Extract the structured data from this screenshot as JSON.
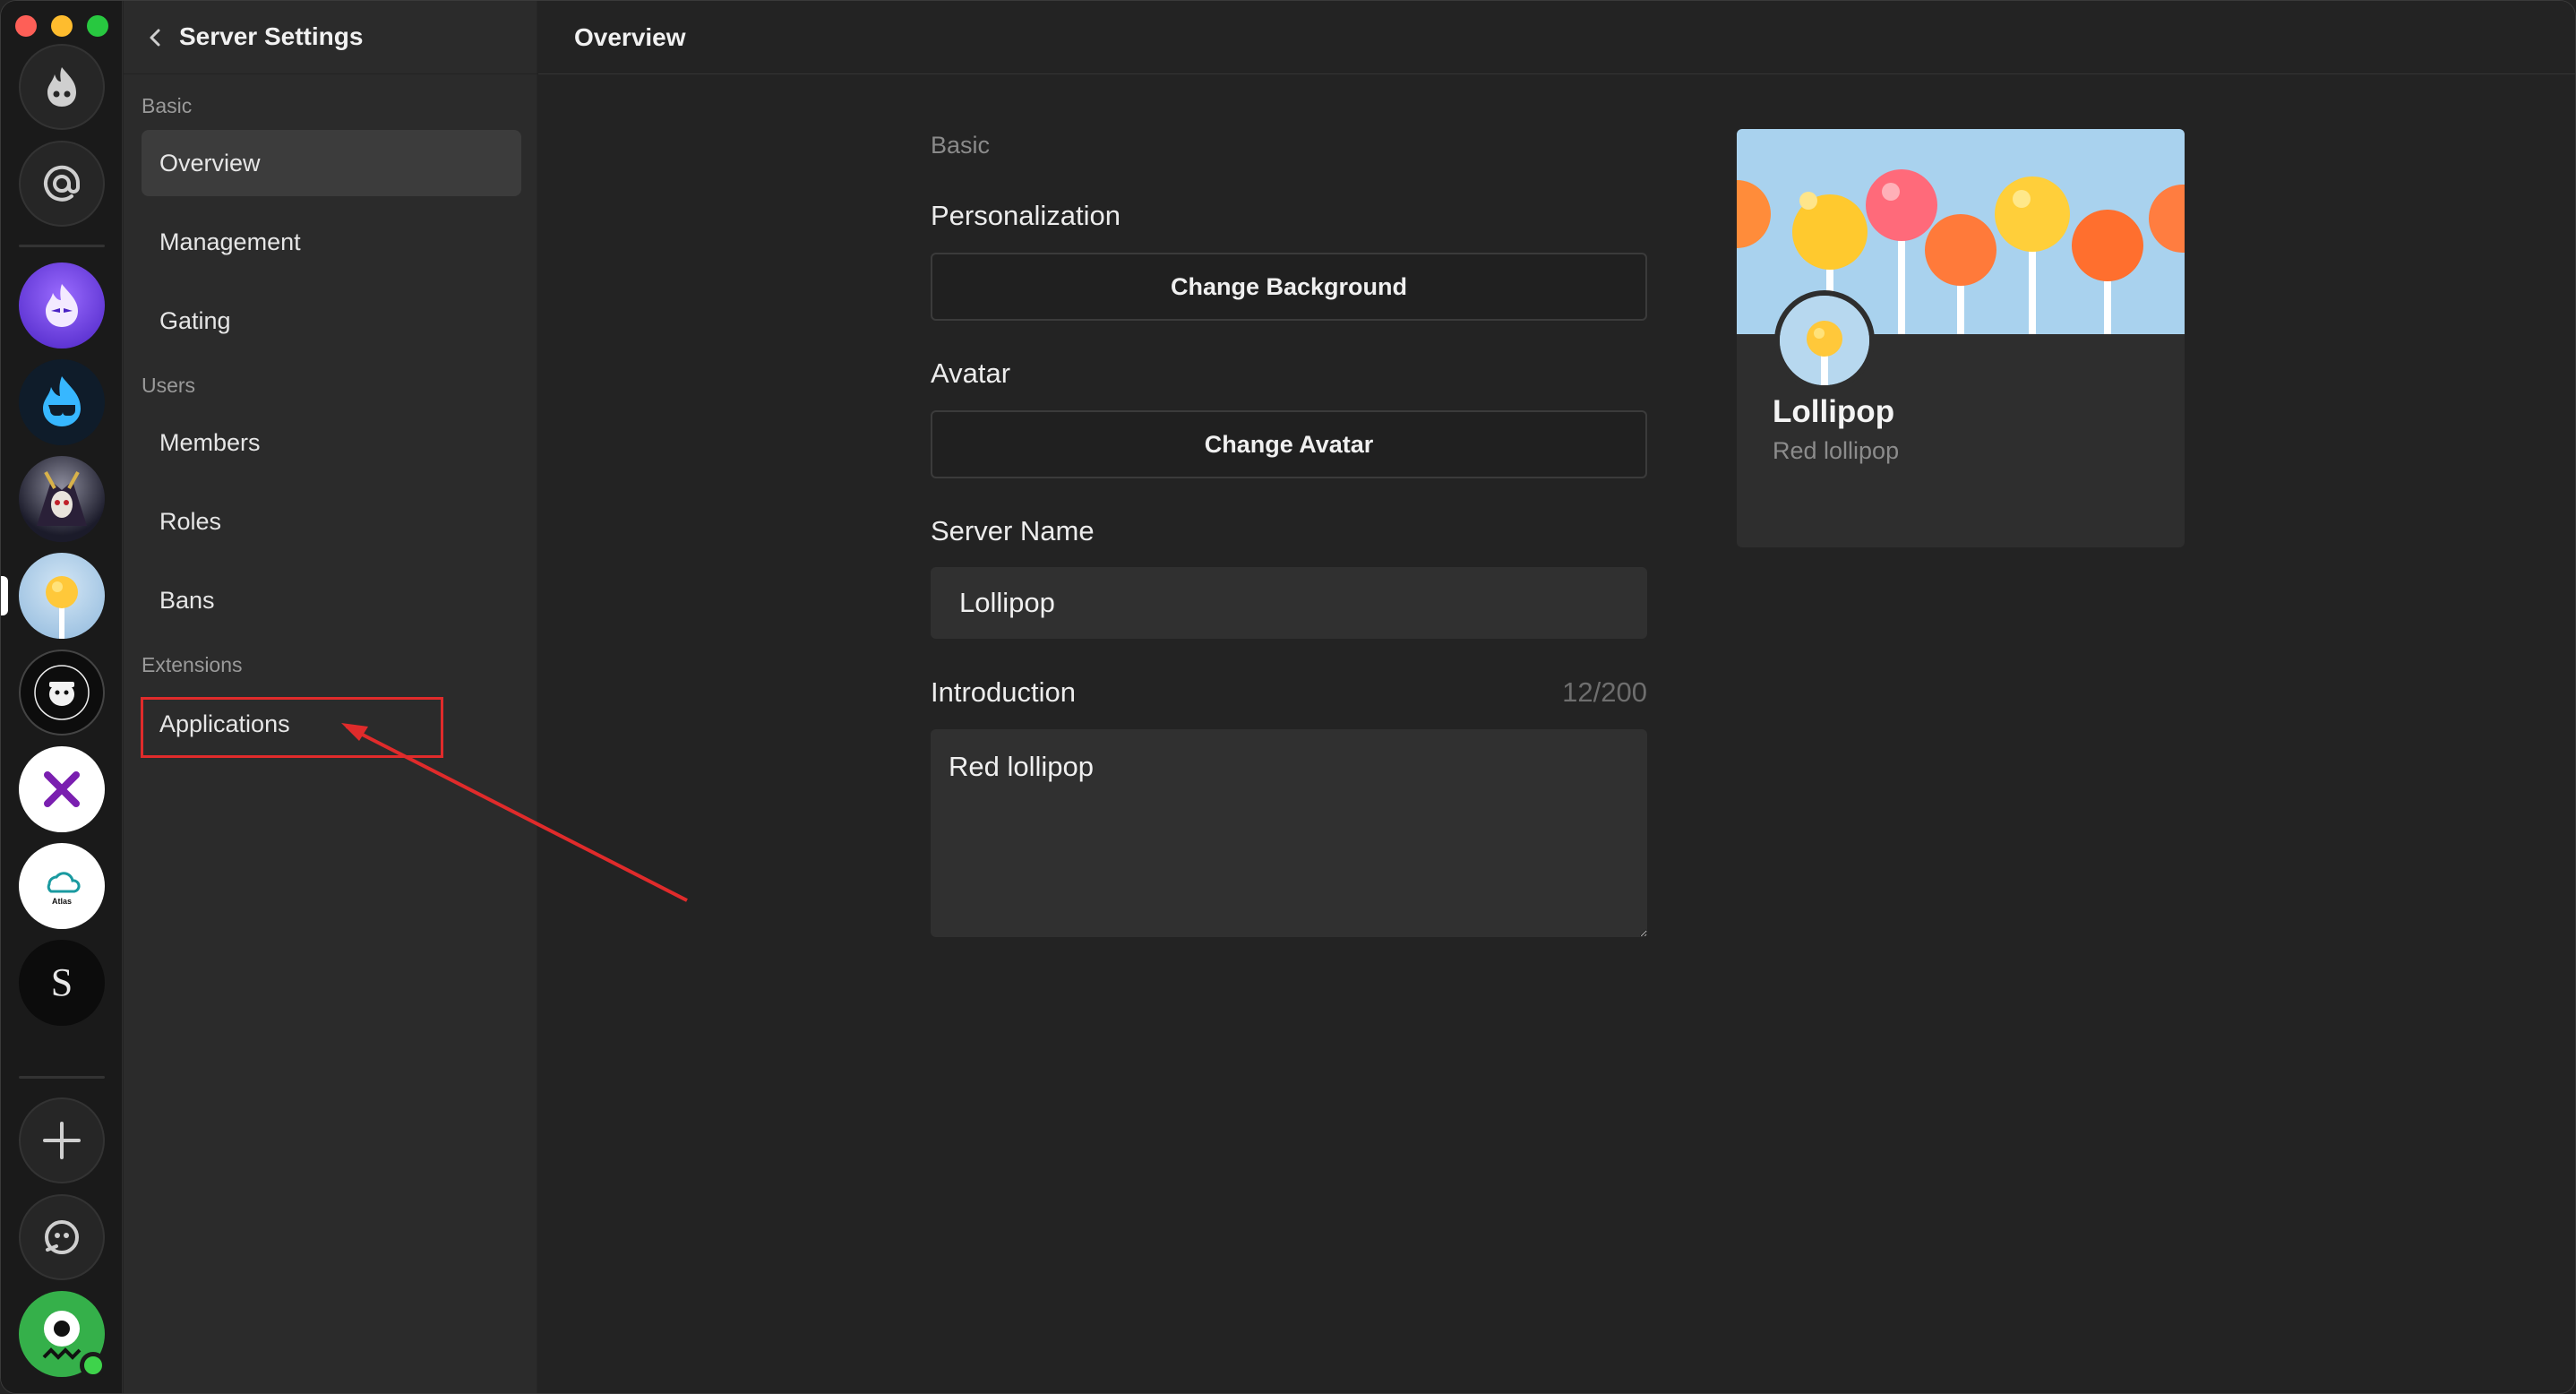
{
  "nav": {
    "title": "Server Settings",
    "sections": {
      "basic": "Basic",
      "users": "Users",
      "extensions": "Extensions"
    },
    "items": {
      "overview": "Overview",
      "management": "Management",
      "gating": "Gating",
      "members": "Members",
      "roles": "Roles",
      "bans": "Bans",
      "applications": "Applications"
    },
    "selected": "Overview"
  },
  "header": {
    "title": "Overview"
  },
  "form": {
    "section_label": "Basic",
    "personalization_label": "Personalization",
    "change_background_label": "Change Background",
    "avatar_label": "Avatar",
    "change_avatar_label": "Change Avatar",
    "server_name_label": "Server Name",
    "server_name_value": "Lollipop",
    "introduction_label": "Introduction",
    "introduction_counter": "12/200",
    "introduction_value": "Red lollipop"
  },
  "preview": {
    "name": "Lollipop",
    "intro": "Red lollipop"
  },
  "rail": {
    "icons": [
      "logo-icon",
      "mention-icon",
      "add-server-icon",
      "discover-icon",
      "profile-avatar"
    ],
    "server_glyphs": {
      "x": "x",
      "s": "S",
      "atlas": "Atlas"
    }
  },
  "colors": {
    "highlight": "#e02b2b",
    "online": "#3ed34b",
    "avatar_green": "#35b04a"
  }
}
